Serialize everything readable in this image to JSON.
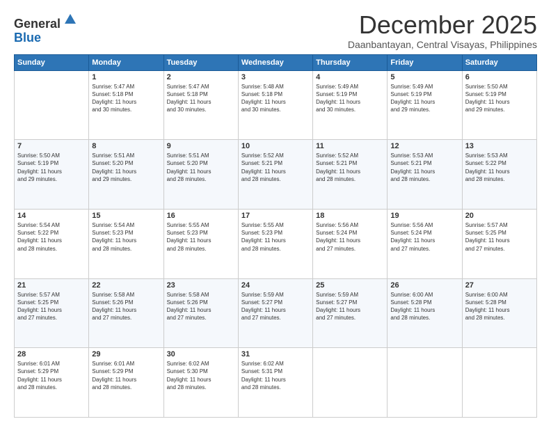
{
  "header": {
    "logo_line1": "General",
    "logo_line2": "Blue",
    "month": "December 2025",
    "location": "Daanbantayan, Central Visayas, Philippines"
  },
  "weekdays": [
    "Sunday",
    "Monday",
    "Tuesday",
    "Wednesday",
    "Thursday",
    "Friday",
    "Saturday"
  ],
  "weeks": [
    [
      {
        "day": "",
        "info": ""
      },
      {
        "day": "1",
        "info": "Sunrise: 5:47 AM\nSunset: 5:18 PM\nDaylight: 11 hours\nand 30 minutes."
      },
      {
        "day": "2",
        "info": "Sunrise: 5:47 AM\nSunset: 5:18 PM\nDaylight: 11 hours\nand 30 minutes."
      },
      {
        "day": "3",
        "info": "Sunrise: 5:48 AM\nSunset: 5:18 PM\nDaylight: 11 hours\nand 30 minutes."
      },
      {
        "day": "4",
        "info": "Sunrise: 5:49 AM\nSunset: 5:19 PM\nDaylight: 11 hours\nand 30 minutes."
      },
      {
        "day": "5",
        "info": "Sunrise: 5:49 AM\nSunset: 5:19 PM\nDaylight: 11 hours\nand 29 minutes."
      },
      {
        "day": "6",
        "info": "Sunrise: 5:50 AM\nSunset: 5:19 PM\nDaylight: 11 hours\nand 29 minutes."
      }
    ],
    [
      {
        "day": "7",
        "info": "Sunrise: 5:50 AM\nSunset: 5:19 PM\nDaylight: 11 hours\nand 29 minutes."
      },
      {
        "day": "8",
        "info": "Sunrise: 5:51 AM\nSunset: 5:20 PM\nDaylight: 11 hours\nand 29 minutes."
      },
      {
        "day": "9",
        "info": "Sunrise: 5:51 AM\nSunset: 5:20 PM\nDaylight: 11 hours\nand 28 minutes."
      },
      {
        "day": "10",
        "info": "Sunrise: 5:52 AM\nSunset: 5:21 PM\nDaylight: 11 hours\nand 28 minutes."
      },
      {
        "day": "11",
        "info": "Sunrise: 5:52 AM\nSunset: 5:21 PM\nDaylight: 11 hours\nand 28 minutes."
      },
      {
        "day": "12",
        "info": "Sunrise: 5:53 AM\nSunset: 5:21 PM\nDaylight: 11 hours\nand 28 minutes."
      },
      {
        "day": "13",
        "info": "Sunrise: 5:53 AM\nSunset: 5:22 PM\nDaylight: 11 hours\nand 28 minutes."
      }
    ],
    [
      {
        "day": "14",
        "info": "Sunrise: 5:54 AM\nSunset: 5:22 PM\nDaylight: 11 hours\nand 28 minutes."
      },
      {
        "day": "15",
        "info": "Sunrise: 5:54 AM\nSunset: 5:23 PM\nDaylight: 11 hours\nand 28 minutes."
      },
      {
        "day": "16",
        "info": "Sunrise: 5:55 AM\nSunset: 5:23 PM\nDaylight: 11 hours\nand 28 minutes."
      },
      {
        "day": "17",
        "info": "Sunrise: 5:55 AM\nSunset: 5:23 PM\nDaylight: 11 hours\nand 28 minutes."
      },
      {
        "day": "18",
        "info": "Sunrise: 5:56 AM\nSunset: 5:24 PM\nDaylight: 11 hours\nand 27 minutes."
      },
      {
        "day": "19",
        "info": "Sunrise: 5:56 AM\nSunset: 5:24 PM\nDaylight: 11 hours\nand 27 minutes."
      },
      {
        "day": "20",
        "info": "Sunrise: 5:57 AM\nSunset: 5:25 PM\nDaylight: 11 hours\nand 27 minutes."
      }
    ],
    [
      {
        "day": "21",
        "info": "Sunrise: 5:57 AM\nSunset: 5:25 PM\nDaylight: 11 hours\nand 27 minutes."
      },
      {
        "day": "22",
        "info": "Sunrise: 5:58 AM\nSunset: 5:26 PM\nDaylight: 11 hours\nand 27 minutes."
      },
      {
        "day": "23",
        "info": "Sunrise: 5:58 AM\nSunset: 5:26 PM\nDaylight: 11 hours\nand 27 minutes."
      },
      {
        "day": "24",
        "info": "Sunrise: 5:59 AM\nSunset: 5:27 PM\nDaylight: 11 hours\nand 27 minutes."
      },
      {
        "day": "25",
        "info": "Sunrise: 5:59 AM\nSunset: 5:27 PM\nDaylight: 11 hours\nand 27 minutes."
      },
      {
        "day": "26",
        "info": "Sunrise: 6:00 AM\nSunset: 5:28 PM\nDaylight: 11 hours\nand 28 minutes."
      },
      {
        "day": "27",
        "info": "Sunrise: 6:00 AM\nSunset: 5:28 PM\nDaylight: 11 hours\nand 28 minutes."
      }
    ],
    [
      {
        "day": "28",
        "info": "Sunrise: 6:01 AM\nSunset: 5:29 PM\nDaylight: 11 hours\nand 28 minutes."
      },
      {
        "day": "29",
        "info": "Sunrise: 6:01 AM\nSunset: 5:29 PM\nDaylight: 11 hours\nand 28 minutes."
      },
      {
        "day": "30",
        "info": "Sunrise: 6:02 AM\nSunset: 5:30 PM\nDaylight: 11 hours\nand 28 minutes."
      },
      {
        "day": "31",
        "info": "Sunrise: 6:02 AM\nSunset: 5:31 PM\nDaylight: 11 hours\nand 28 minutes."
      },
      {
        "day": "",
        "info": ""
      },
      {
        "day": "",
        "info": ""
      },
      {
        "day": "",
        "info": ""
      }
    ]
  ]
}
